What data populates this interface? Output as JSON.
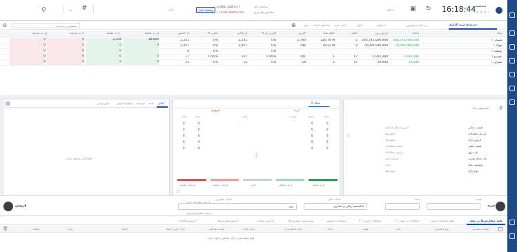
{
  "topbar": {
    "time": "16:18:44",
    "date": "سه‌شنبه",
    "date_sub": "۱۴۰۳/۰۱/۰۱",
    "search_placeholder": "ستون",
    "index_label": "شاخص کل",
    "index_value": "2,061,150.477",
    "index_change": "(+0.91,049.07%)",
    "index_sub": "شاخص هم وزن",
    "index_badge": "وضعیت بازار",
    "market_status": "بازار",
    "hash_label": "#"
  },
  "watchlist": {
    "tabs": [
      "دیده‌بان سبد گذاری",
      "دیده‌بان پیش‌فرض",
      "سبدهای",
      "تابلو",
      "صف خرید",
      "نمادهای انتخاب",
      "سود"
    ],
    "filter_placeholder": "جستجو در دیده‌بان",
    "headers": [
      "نماد",
      "مانده",
      "ارزش روز",
      "حجم",
      "حجم مبنا",
      "آخرین",
      "% آخرین ق",
      "ق پایانی",
      "% پایانی",
      "ق حدبس",
      "ق ب تقاضا",
      "ح ب تقاضا",
      "ح ب عرضه",
      "ق ب عرضه"
    ],
    "rows": [
      [
        "شبندر ۱",
        "368,741,000,000",
        "246,741,000,000",
        "2",
        "226.76 M",
        "2,700",
        "0%",
        "2,241",
        "0%",
        "2,241",
        "38,000",
        "2,144",
        "0",
        "0"
      ],
      [
        "فولاد ۱",
        "78,000,000,000",
        "70,000,000,000",
        "2",
        "78.52 M",
        "796",
        "0%",
        "2,057",
        "0%",
        "2,057",
        "0",
        "0",
        "0",
        "0"
      ],
      [
        "وبملت ۱",
        "",
        "",
        "",
        "",
        "",
        "0%",
        "",
        "0%",
        "8",
        "",
        "0",
        "0",
        "0"
      ],
      [
        "خودرو ۱",
        "1,022,280",
        "1,022,280",
        "17",
        "1",
        "101",
        "0.95%",
        "121",
        "0.95%",
        "17",
        "0",
        "0",
        "0",
        "0"
      ],
      [
        "شتران ۱",
        "19,000",
        "19,000",
        "17",
        "1",
        "18",
        "0%",
        "15",
        "0%",
        "15",
        "0",
        "0",
        "0",
        "0"
      ]
    ]
  },
  "left_panel": {
    "tabs": [
      "پیش‌نویس",
      "سفارش",
      "سهام",
      "تاریخچه",
      "همه",
      "اعلان"
    ],
    "empty_text": "اطلاعاتی وجود ندارد"
  },
  "center_panel": {
    "title_buy": "خرید",
    "title_sell": "فروش",
    "cols": [
      "تعداد",
      "حجم",
      "قیمت"
    ],
    "rows": [
      "0",
      "0",
      "0",
      "0",
      "0",
      "0"
    ],
    "legend": [
      "خرید حقیقی",
      "خرید حقوقی",
      "فروش حقیقی",
      "فروش حقوقی"
    ],
    "legend_mid": "خنثی",
    "depth_tab": "۵ سطر"
  },
  "right_panel": {
    "search_placeholder": "جستجوی نماد",
    "info": [
      [
        "قیمت پایانی",
        "آخرین/ پایان معامله"
      ],
      [
        "ارزش معاملات",
        "حجم مبنا"
      ],
      [
        "ارزش بازار",
        "حجم کل"
      ],
      [
        "قیمت قبلی",
        "تعداد معاملات"
      ],
      [
        "بازه روز",
        "ارزش معاملات"
      ],
      [
        "بازه مجاز قیمت",
        "ارزش بازار"
      ],
      [
        "وضعیت نماد",
        "بازار"
      ],
      [
        "نوع بازار",
        "نوع نماد"
      ]
    ]
  },
  "orderbar": {
    "buy_label": "خرید",
    "sell_label": "فروش",
    "price_label": "قیمت",
    "qty_label": "تعداد",
    "validity_label": "اعتبار سفارش",
    "validity_value": "روز",
    "account_label": "حساب مالی",
    "account_value": "ماکسیمم ریالی و اعتباری",
    "summary_label": "ارزش سفارش خرید",
    "summary_value": "0 ریال",
    "fee_label": "ارزش سفارش فروش"
  },
  "bottom": {
    "tabs": [
      "همه سفارش‌ها در صف",
      "همه معاملات امروز",
      "معاملات در صف (۰)",
      "معاملات امروز (۰)",
      "معاملات تجمیعی",
      "پیش‌نویس سفارش‌ها",
      "گزارش حساب",
      "آرشیو سفارش‌ها",
      "آرشیو معاملات"
    ],
    "headers": [
      "قیمت سفارش",
      "نوع سفارش",
      "نماد",
      "قیمت",
      "تعداد",
      "حجم انجام شده",
      "حجم مانده",
      "قیمت میانگین",
      "محل تامین اعتبار",
      "اعتبار",
      "زمان",
      "عملیات"
    ],
    "empty_text": "هیچ سفارشی برای نمایش وجود ندارد"
  }
}
